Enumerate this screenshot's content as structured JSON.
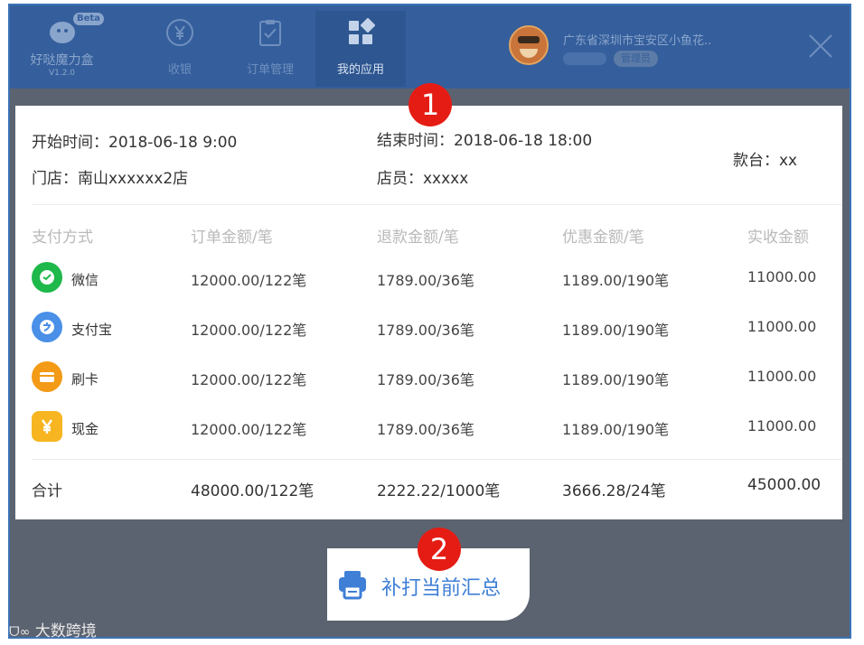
{
  "app": {
    "logo_name": "好哒魔力盒",
    "logo_version": "V1.2.0",
    "logo_badge": "Beta",
    "nav": [
      {
        "label": "收银",
        "icon": "yen-circle-icon"
      },
      {
        "label": "订单管理",
        "icon": "clipboard-icon"
      },
      {
        "label": "我的应用",
        "icon": "apps-grid-icon",
        "active": true
      }
    ],
    "user": {
      "store": "广东省深圳市宝安区小鱼花..",
      "role": "管理员"
    },
    "close_icon": "close-icon"
  },
  "summary": {
    "start_time": "开始时间：2018-06-18 9:00",
    "end_time": "结束时间：2018-06-18 18:00",
    "register": "款台：xx",
    "store": "门店：南山xxxxxx2店",
    "clerk": "店员：xxxxx"
  },
  "table": {
    "headers": [
      "支付方式",
      "订单金额/笔",
      "退款金额/笔",
      "优惠金额/笔",
      "实收金额"
    ],
    "rows": [
      {
        "method": "微信",
        "icon": "wechat-icon",
        "color": "#1fb84a",
        "order": "12000.00/122笔",
        "refund": "1789.00/36笔",
        "discount": "1189.00/190笔",
        "received": "11000.00"
      },
      {
        "method": "支付宝",
        "icon": "alipay-icon",
        "color": "#4a8fe8",
        "order": "12000.00/122笔",
        "refund": "1789.00/36笔",
        "discount": "1189.00/190笔",
        "received": "11000.00"
      },
      {
        "method": "刷卡",
        "icon": "card-icon",
        "color": "#f39a16",
        "order": "12000.00/122笔",
        "refund": "1789.00/36笔",
        "discount": "1189.00/190笔",
        "received": "11000.00"
      },
      {
        "method": "现金",
        "icon": "cash-icon",
        "color": "#f7b521",
        "order": "12000.00/122笔",
        "refund": "1789.00/36笔",
        "discount": "1189.00/190笔",
        "received": "11000.00"
      }
    ],
    "total": {
      "label": "合计",
      "order": "48000.00/122笔",
      "refund": "2222.22/1000笔",
      "discount": "3666.28/24笔",
      "received": "45000.00"
    }
  },
  "reprint_button": {
    "label": "补打当前汇总",
    "icon": "printer-icon",
    "color": "#3f7fd6"
  },
  "markers": [
    "1",
    "2"
  ],
  "watermark": "大数跨境"
}
